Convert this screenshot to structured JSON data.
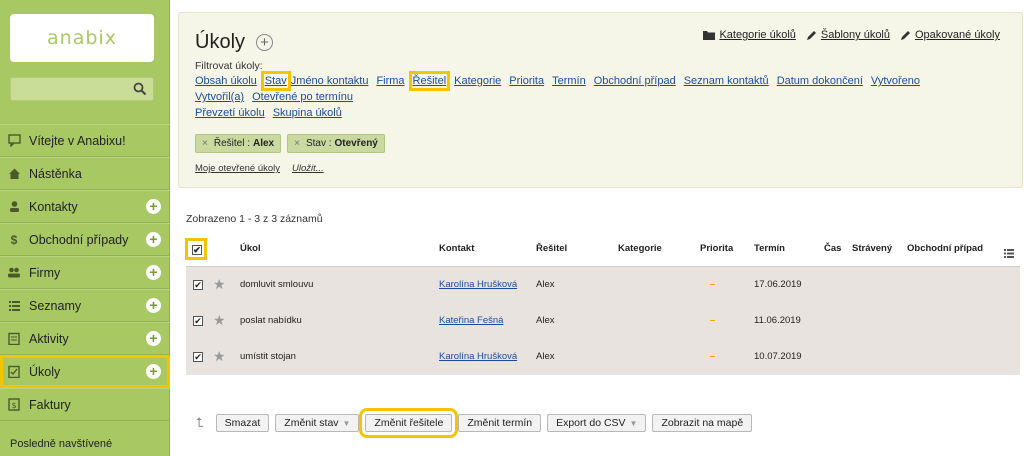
{
  "sidebar": {
    "logo": "anabix",
    "search_placeholder": "",
    "items": [
      {
        "label": "Vítejte v Anabixu!",
        "icon": "chat-icon",
        "plus": false
      },
      {
        "label": "Nástěnka",
        "icon": "home-icon",
        "plus": false
      },
      {
        "label": "Kontakty",
        "icon": "person-icon",
        "plus": true
      },
      {
        "label": "Obchodní případy",
        "icon": "dollar-icon",
        "plus": true
      },
      {
        "label": "Firmy",
        "icon": "people-icon",
        "plus": true
      },
      {
        "label": "Seznamy",
        "icon": "list-icon",
        "plus": true
      },
      {
        "label": "Aktivity",
        "icon": "clipboard-icon",
        "plus": true
      },
      {
        "label": "Úkoly",
        "icon": "task-icon",
        "plus": true
      },
      {
        "label": "Faktury",
        "icon": "invoice-icon",
        "plus": false
      }
    ],
    "recent_label": "Posledně navštívené"
  },
  "header": {
    "title": "Úkoly",
    "top_links": [
      "Kategorie úkolů",
      "Šablony úkolů",
      "Opakované úkoly"
    ],
    "filter_label": "Filtrovat úkoly:",
    "filter_links_row1": [
      "Obsah úkolu",
      "Stav",
      "Jméno kontaktu",
      "Firma",
      "Řešitel",
      "Kategorie",
      "Priorita",
      "Termín",
      "Obchodní případ",
      "Seznam kontaktů",
      "Datum dokončení",
      "Vytvořeno"
    ],
    "filter_links_row2": [
      "Vytvořil(a)",
      "Otevřené po termínu"
    ],
    "filter_links_row3": [
      "Převzetí úkolu",
      "Skupina úkolů"
    ],
    "chips": [
      {
        "key": "Řešitel :",
        "value": "Alex"
      },
      {
        "key": "Stav :",
        "value": "Otevřený"
      }
    ],
    "saved_filter": "Moje otevřené úkoly",
    "save_link": "Uložit..."
  },
  "table": {
    "shown_text": "Zobrazeno 1 - 3 z 3 záznamů",
    "columns": [
      "Úkol",
      "Kontakt",
      "Řešitel",
      "Kategorie",
      "Priorita",
      "Termín",
      "Čas",
      "Strávený",
      "Obchodní případ"
    ],
    "rows": [
      {
        "task": "domluvit smlouvu",
        "contact": "Karolína Hrušková",
        "assignee": "Alex",
        "category": "",
        "priority": "–",
        "due": "17.06.2019"
      },
      {
        "task": "poslat nabídku",
        "contact": "Kateřina Fešná",
        "assignee": "Alex",
        "category": "",
        "priority": "–",
        "due": "11.06.2019"
      },
      {
        "task": "umístit stojan",
        "contact": "Karolína Hrušková",
        "assignee": "Alex",
        "category": "",
        "priority": "–",
        "due": "10.07.2019"
      }
    ]
  },
  "actions": {
    "buttons": [
      {
        "label": "Smazat",
        "dropdown": false
      },
      {
        "label": "Změnit stav",
        "dropdown": true
      },
      {
        "label": "Změnit řešitele",
        "dropdown": false
      },
      {
        "label": "Změnit termín",
        "dropdown": false
      },
      {
        "label": "Export do CSV",
        "dropdown": true
      },
      {
        "label": "Zobrazit na mapě",
        "dropdown": false
      }
    ]
  },
  "colors": {
    "sidebar_bg": "#a8c864",
    "highlight": "#f5c400",
    "link": "#1a4da0",
    "panel_bg": "#f6f6e8",
    "rows_bg": "#e9e3df"
  }
}
